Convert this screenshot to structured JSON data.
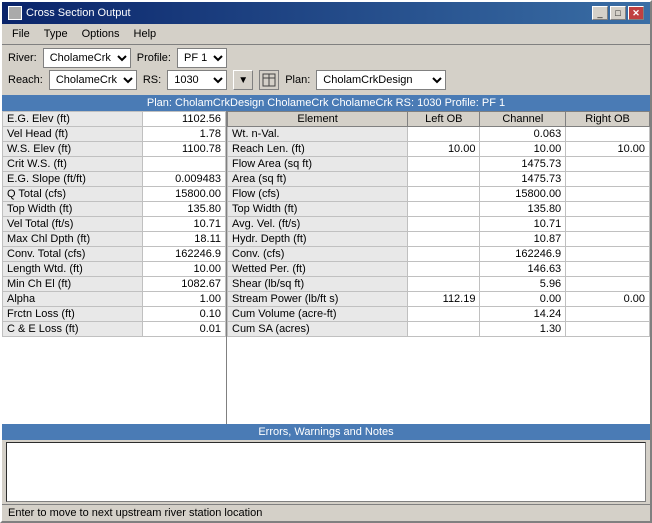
{
  "window": {
    "title": "Cross Section Output"
  },
  "title_buttons": {
    "minimize": "_",
    "maximize": "□",
    "close": "✕"
  },
  "menu": {
    "items": [
      "File",
      "Type",
      "Options",
      "Help"
    ]
  },
  "toolbar": {
    "river_label": "River:",
    "river_value": "CholameCrk",
    "profile_label": "Profile:",
    "profile_value": "PF 1",
    "reach_label": "Reach:",
    "reach_value": "CholameCrk",
    "rs_label": "RS:",
    "rs_value": "1030",
    "plan_label": "Plan:",
    "plan_value": "CholamCrkDesign"
  },
  "info_bar": {
    "text": "Plan: CholamCrkDesign    CholameCrk    CholameCrk    RS: 1030    Profile: PF 1"
  },
  "left_table": {
    "rows": [
      {
        "label": "E.G. Elev (ft)",
        "value": "1102.56"
      },
      {
        "label": "Vel Head (ft)",
        "value": "1.78"
      },
      {
        "label": "W.S. Elev (ft)",
        "value": "1100.78"
      },
      {
        "label": "Crit W.S. (ft)",
        "value": ""
      },
      {
        "label": "E.G. Slope (ft/ft)",
        "value": "0.009483"
      },
      {
        "label": "Q Total (cfs)",
        "value": "15800.00"
      },
      {
        "label": "Top Width (ft)",
        "value": "135.80"
      },
      {
        "label": "Vel Total (ft/s)",
        "value": "10.71"
      },
      {
        "label": "Max Chl Dpth (ft)",
        "value": "18.11"
      },
      {
        "label": "Conv. Total (cfs)",
        "value": "162246.9"
      },
      {
        "label": "Length Wtd. (ft)",
        "value": "10.00"
      },
      {
        "label": "Min Ch El (ft)",
        "value": "1082.67"
      },
      {
        "label": "Alpha",
        "value": "1.00"
      },
      {
        "label": "Frctn Loss (ft)",
        "value": "0.10"
      },
      {
        "label": "C & E Loss (ft)",
        "value": "0.01"
      }
    ]
  },
  "right_table": {
    "headers": [
      "Element",
      "Left OB",
      "Channel",
      "Right OB"
    ],
    "rows": [
      {
        "element": "Wt. n-Val.",
        "left_ob": "",
        "channel": "0.063",
        "right_ob": ""
      },
      {
        "element": "Reach Len. (ft)",
        "left_ob": "10.00",
        "channel": "10.00",
        "right_ob": "10.00"
      },
      {
        "element": "Flow Area (sq ft)",
        "left_ob": "",
        "channel": "1475.73",
        "right_ob": ""
      },
      {
        "element": "Area (sq ft)",
        "left_ob": "",
        "channel": "1475.73",
        "right_ob": ""
      },
      {
        "element": "Flow (cfs)",
        "left_ob": "",
        "channel": "15800.00",
        "right_ob": ""
      },
      {
        "element": "Top Width (ft)",
        "left_ob": "",
        "channel": "135.80",
        "right_ob": ""
      },
      {
        "element": "Avg. Vel. (ft/s)",
        "left_ob": "",
        "channel": "10.71",
        "right_ob": ""
      },
      {
        "element": "Hydr. Depth (ft)",
        "left_ob": "",
        "channel": "10.87",
        "right_ob": ""
      },
      {
        "element": "Conv. (cfs)",
        "left_ob": "",
        "channel": "162246.9",
        "right_ob": ""
      },
      {
        "element": "Wetted Per. (ft)",
        "left_ob": "",
        "channel": "146.63",
        "right_ob": ""
      },
      {
        "element": "Shear (lb/sq ft)",
        "left_ob": "",
        "channel": "5.96",
        "right_ob": ""
      },
      {
        "element": "Stream Power (lb/ft s)",
        "left_ob": "112.19",
        "channel": "0.00",
        "right_ob": "0.00"
      },
      {
        "element": "Cum Volume (acre-ft)",
        "left_ob": "",
        "channel": "14.24",
        "right_ob": ""
      },
      {
        "element": "Cum SA (acres)",
        "left_ob": "",
        "channel": "1.30",
        "right_ob": ""
      }
    ]
  },
  "errors_bar": {
    "text": "Errors, Warnings and Notes"
  },
  "status_bar": {
    "text": "Enter to move to next upstream river station location"
  }
}
